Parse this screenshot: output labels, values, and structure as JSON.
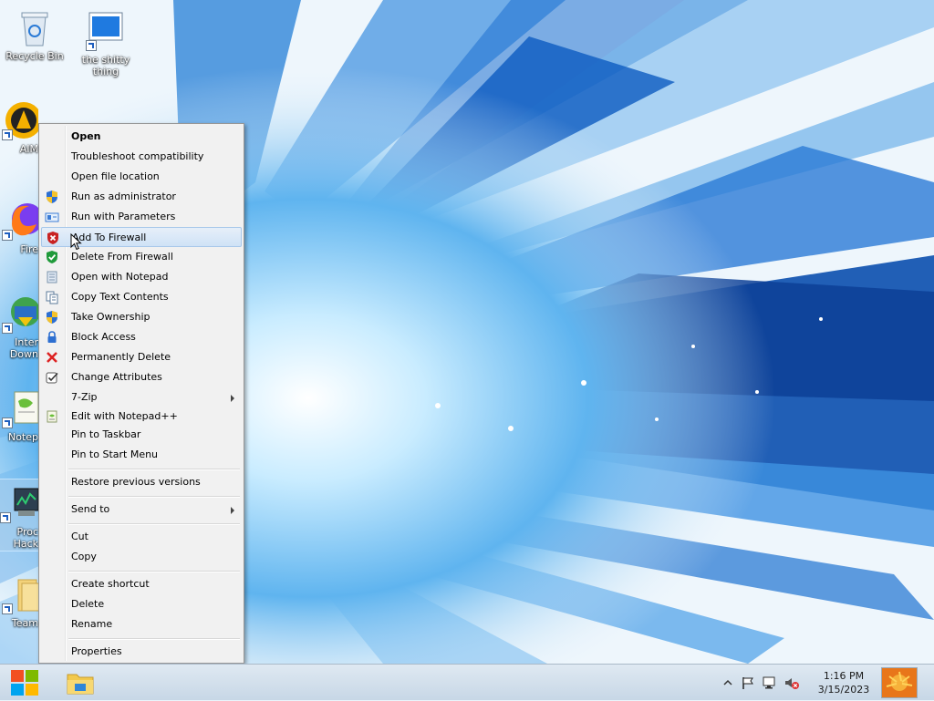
{
  "desktop": {
    "icons": [
      {
        "label": "Recycle Bin",
        "icon": "recycle-bin-icon"
      },
      {
        "label": "the shitty thing",
        "icon": "app-window-icon"
      },
      {
        "label": "AIM",
        "icon": "aimp-icon"
      },
      {
        "label": "Fire",
        "icon": "firefox-icon"
      },
      {
        "label": "Inter Down",
        "icon": "internet-download-icon"
      },
      {
        "label": "Notep",
        "icon": "notepad-icon"
      },
      {
        "label": "Proc Hack",
        "icon": "process-hacker-icon"
      },
      {
        "label": "Team",
        "icon": "folder-icon"
      }
    ]
  },
  "context_menu": {
    "items": [
      {
        "label": "Open",
        "bold": true
      },
      {
        "label": "Troubleshoot compatibility"
      },
      {
        "label": "Open file location"
      },
      {
        "label": "Run as administrator",
        "icon": "uac-shield-icon"
      },
      {
        "label": "Run with Parameters",
        "icon": "parameters-icon"
      },
      {
        "label": "Add To Firewall",
        "icon": "firewall-block-icon",
        "highlighted": true
      },
      {
        "label": "Delete From Firewall",
        "icon": "firewall-allow-icon"
      },
      {
        "label": "Open with Notepad",
        "icon": "notepad-icon"
      },
      {
        "label": "Copy Text Contents",
        "icon": "copy-text-icon"
      },
      {
        "label": "Take Ownership",
        "icon": "uac-shield-icon"
      },
      {
        "label": "Block Access",
        "icon": "lock-icon"
      },
      {
        "label": "Permanently Delete",
        "icon": "red-x-icon"
      },
      {
        "label": "Change Attributes",
        "icon": "checkbox-icon"
      },
      {
        "label": "7-Zip",
        "submenu": true
      },
      {
        "label": "Edit with Notepad++",
        "icon": "notepadpp-icon"
      },
      {
        "label": "Pin to Taskbar"
      },
      {
        "label": "Pin to Start Menu"
      },
      {
        "label": "Restore previous versions"
      },
      {
        "label": "Send to",
        "submenu": true
      },
      {
        "label": "Cut"
      },
      {
        "label": "Copy"
      },
      {
        "label": "Create shortcut"
      },
      {
        "label": "Delete"
      },
      {
        "label": "Rename"
      },
      {
        "label": "Properties"
      }
    ]
  },
  "taskbar": {
    "start_icon": "windows-logo-icon",
    "pinned": [
      {
        "icon": "file-explorer-icon"
      }
    ],
    "tray": {
      "icons": [
        "show-hidden-icons-chevron",
        "action-center-flag-icon",
        "network-icon",
        "volume-muted-icon"
      ],
      "time": "1:16 PM",
      "date": "3/15/2023"
    }
  },
  "colors": {
    "menu_bg": "#f1f1f1",
    "menu_highlight": "#cfe2f6",
    "taskbar_bg": "#d3e0ec",
    "wallpaper_blue": "#1a6fd1"
  }
}
